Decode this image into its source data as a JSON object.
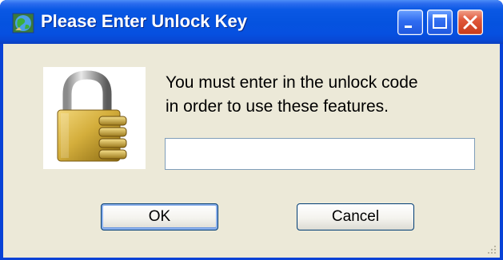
{
  "window": {
    "title": "Please Enter Unlock Key",
    "app_icon": "globe-icon",
    "controls": [
      "minimize-icon",
      "maximize-icon",
      "close-icon"
    ]
  },
  "dialog": {
    "image": "padlock-icon",
    "message": "You must enter in the unlock code\nin order to use these features.",
    "unlock_input": {
      "value": "",
      "placeholder": ""
    },
    "ok_label": "OK",
    "cancel_label": "Cancel"
  },
  "colors": {
    "titlebar": "#0553df",
    "client_background": "#ece9d8",
    "close_button": "#e0583a",
    "button_border": "#003c74"
  }
}
